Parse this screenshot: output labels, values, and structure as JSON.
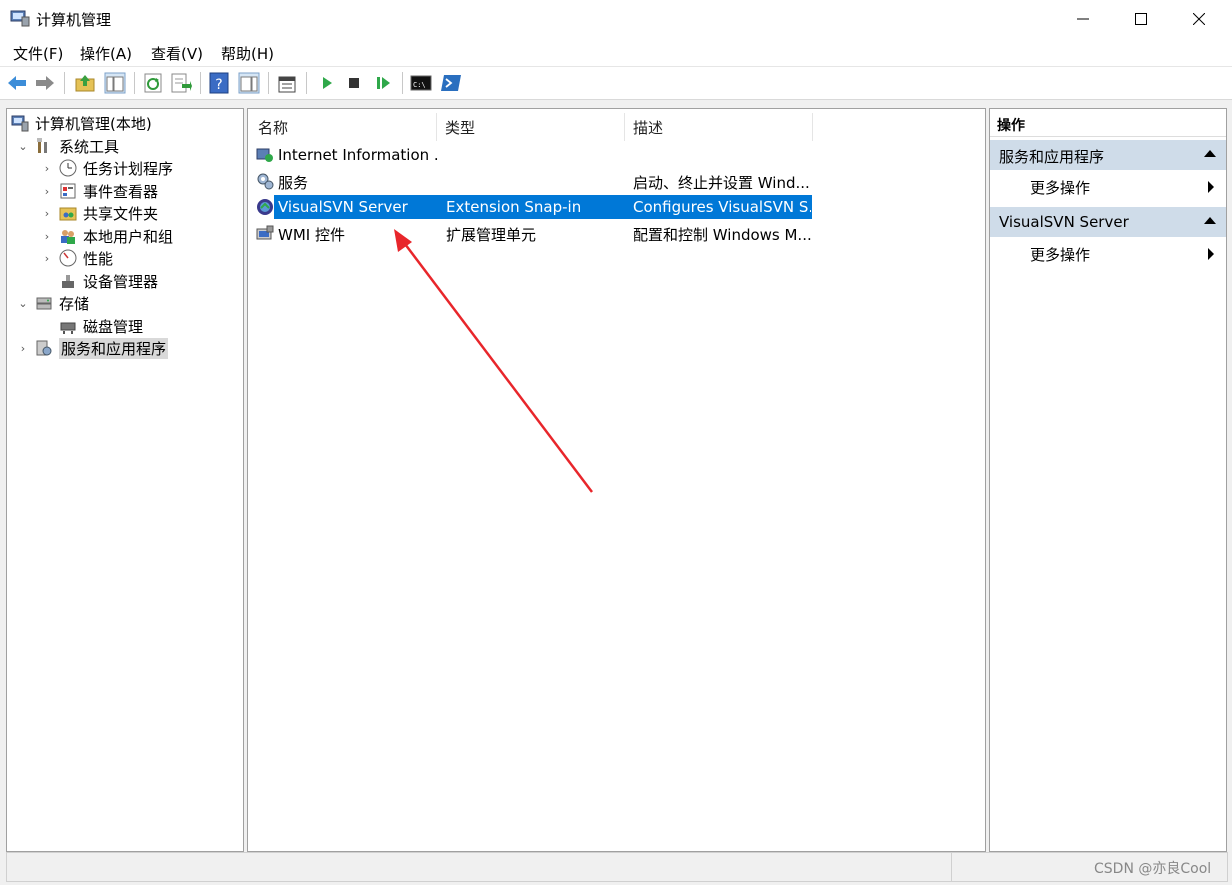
{
  "window": {
    "title": "计算机管理",
    "controls": [
      "minimize",
      "maximize",
      "close"
    ]
  },
  "menu": [
    "文件(F)",
    "操作(A)",
    "查看(V)",
    "帮助(H)"
  ],
  "toolbar": {
    "icons": [
      "back-arrow-icon",
      "forward-arrow-icon",
      "up-folder-icon",
      "show-hide-tree-icon",
      "refresh-icon",
      "export-list-icon",
      "help-icon",
      "show-hide-action-pane-icon",
      "properties-icon",
      "start-service-icon",
      "stop-service-icon",
      "resume-service-icon",
      "command-prompt-icon",
      "powershell-icon"
    ]
  },
  "tree": {
    "root": "计算机管理(本地)",
    "items": [
      {
        "label": "系统工具",
        "level": 1,
        "expander": "expanded"
      },
      {
        "label": "任务计划程序",
        "level": 2,
        "expander": "collapsed"
      },
      {
        "label": "事件查看器",
        "level": 2,
        "expander": "collapsed"
      },
      {
        "label": "共享文件夹",
        "level": 2,
        "expander": "collapsed"
      },
      {
        "label": "本地用户和组",
        "level": 2,
        "expander": "collapsed"
      },
      {
        "label": "性能",
        "level": 2,
        "expander": "collapsed"
      },
      {
        "label": "设备管理器",
        "level": 2,
        "expander": "none"
      },
      {
        "label": "存储",
        "level": 1,
        "expander": "expanded"
      },
      {
        "label": "磁盘管理",
        "level": 2,
        "expander": "none"
      },
      {
        "label": "服务和应用程序",
        "level": 1,
        "expander": "collapsed",
        "selected": true
      }
    ]
  },
  "list": {
    "columns": [
      "名称",
      "类型",
      "描述"
    ],
    "rows": [
      {
        "name": "Internet Information ...",
        "type": "",
        "desc": "",
        "icon": "iis-icon"
      },
      {
        "name": "服务",
        "type": "",
        "desc": "启动、终止并设置 Wind...",
        "icon": "services-gear-icon"
      },
      {
        "name": "VisualSVN Server",
        "type": "Extension Snap-in",
        "desc": "Configures VisualSVN S...",
        "icon": "visualsvn-icon",
        "selected": true
      },
      {
        "name": "WMI 控件",
        "type": "扩展管理单元",
        "desc": "配置和控制 Windows M...",
        "icon": "wmi-icon"
      }
    ]
  },
  "actions": {
    "header": "操作",
    "groups": [
      {
        "title": "服务和应用程序",
        "items": [
          "更多操作"
        ]
      },
      {
        "title": "VisualSVN Server",
        "items": [
          "更多操作"
        ]
      }
    ]
  },
  "watermark": "CSDN @亦良Cool",
  "colors": {
    "selection": "#0078d7",
    "action_group_bg": "#cfdce9",
    "annotation_arrow": "#e8262b"
  }
}
